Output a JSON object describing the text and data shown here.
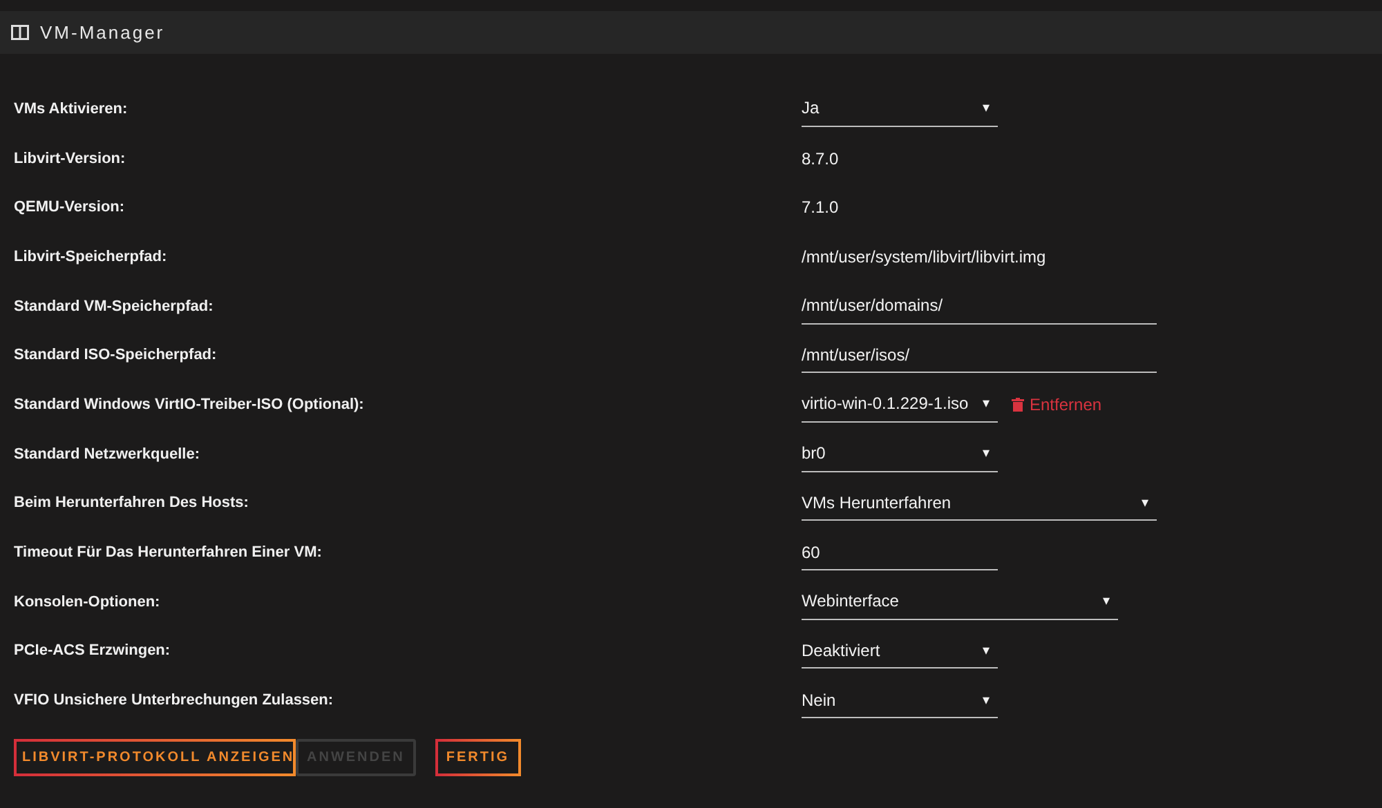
{
  "panel": {
    "title": "VM-Manager"
  },
  "rows": [
    {
      "label": "VMs Aktivieren:",
      "kind": "select",
      "value": "Ja"
    },
    {
      "label": "Libvirt-Version:",
      "kind": "text",
      "value": "8.7.0"
    },
    {
      "label": "QEMU-Version:",
      "kind": "text",
      "value": "7.1.0"
    },
    {
      "label": "Libvirt-Speicherpfad:",
      "kind": "text",
      "value": "/mnt/user/system/libvirt/libvirt.img"
    },
    {
      "label": "Standard VM-Speicherpfad:",
      "kind": "input",
      "value": "/mnt/user/domains/"
    },
    {
      "label": "Standard ISO-Speicherpfad:",
      "kind": "input",
      "value": "/mnt/user/isos/"
    },
    {
      "label": "Standard Windows VirtIO-Treiber-ISO (Optional):",
      "kind": "select",
      "value": "virtio-win-0.1.229-1.iso",
      "remove": "Entfernen"
    },
    {
      "label": "Standard Netzwerkquelle:",
      "kind": "select",
      "value": "br0"
    },
    {
      "label": "Beim Herunterfahren Des Hosts:",
      "kind": "select",
      "value": "VMs Herunterfahren"
    },
    {
      "label": "Timeout Für Das Herunterfahren Einer VM:",
      "kind": "input",
      "value": "60"
    },
    {
      "label": "Konsolen-Optionen:",
      "kind": "select",
      "value": "Webinterface"
    },
    {
      "label": "PCIe-ACS Erzwingen:",
      "kind": "select",
      "value": "Deaktiviert"
    },
    {
      "label": "VFIO Unsichere Unterbrechungen Zulassen:",
      "kind": "select",
      "value": "Nein"
    }
  ],
  "log_button": {
    "label": "LIBVIRT-PROTOKOLL ANZEIGEN"
  },
  "buttons": [
    {
      "label": "ANWENDEN",
      "disabled": true
    },
    {
      "label": "FERTIG",
      "disabled": false
    }
  ],
  "caret": "▾"
}
